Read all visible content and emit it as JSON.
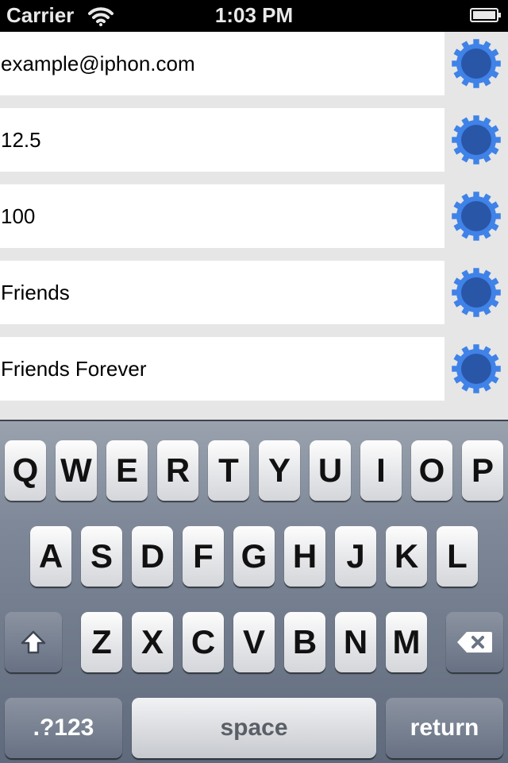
{
  "status_bar": {
    "carrier": "Carrier",
    "time": "1:03 PM",
    "icons": [
      "wifi-icon",
      "battery-icon"
    ]
  },
  "fields": [
    {
      "value": "example@iphon.com",
      "icon": "gear-icon"
    },
    {
      "value": "12.5",
      "icon": "gear-icon"
    },
    {
      "value": "100",
      "icon": "gear-icon"
    },
    {
      "value": "Friends",
      "icon": "gear-icon"
    },
    {
      "value": "Friends Forever",
      "icon": "gear-icon"
    }
  ],
  "colors": {
    "gear_outer": "#3f82e8",
    "gear_inner": "#2a56a8",
    "field_bg": "#ffffff",
    "page_bg": "#e6e6e6"
  },
  "keyboard": {
    "row1": [
      "Q",
      "W",
      "E",
      "R",
      "T",
      "Y",
      "U",
      "I",
      "O",
      "P"
    ],
    "row2": [
      "A",
      "S",
      "D",
      "F",
      "G",
      "H",
      "J",
      "K",
      "L"
    ],
    "row3": [
      "Z",
      "X",
      "C",
      "V",
      "B",
      "N",
      "M"
    ],
    "shift_icon": "shift-icon",
    "backspace_icon": "backspace-icon",
    "numbers_label": ".?123",
    "space_label": "space",
    "return_label": "return"
  }
}
